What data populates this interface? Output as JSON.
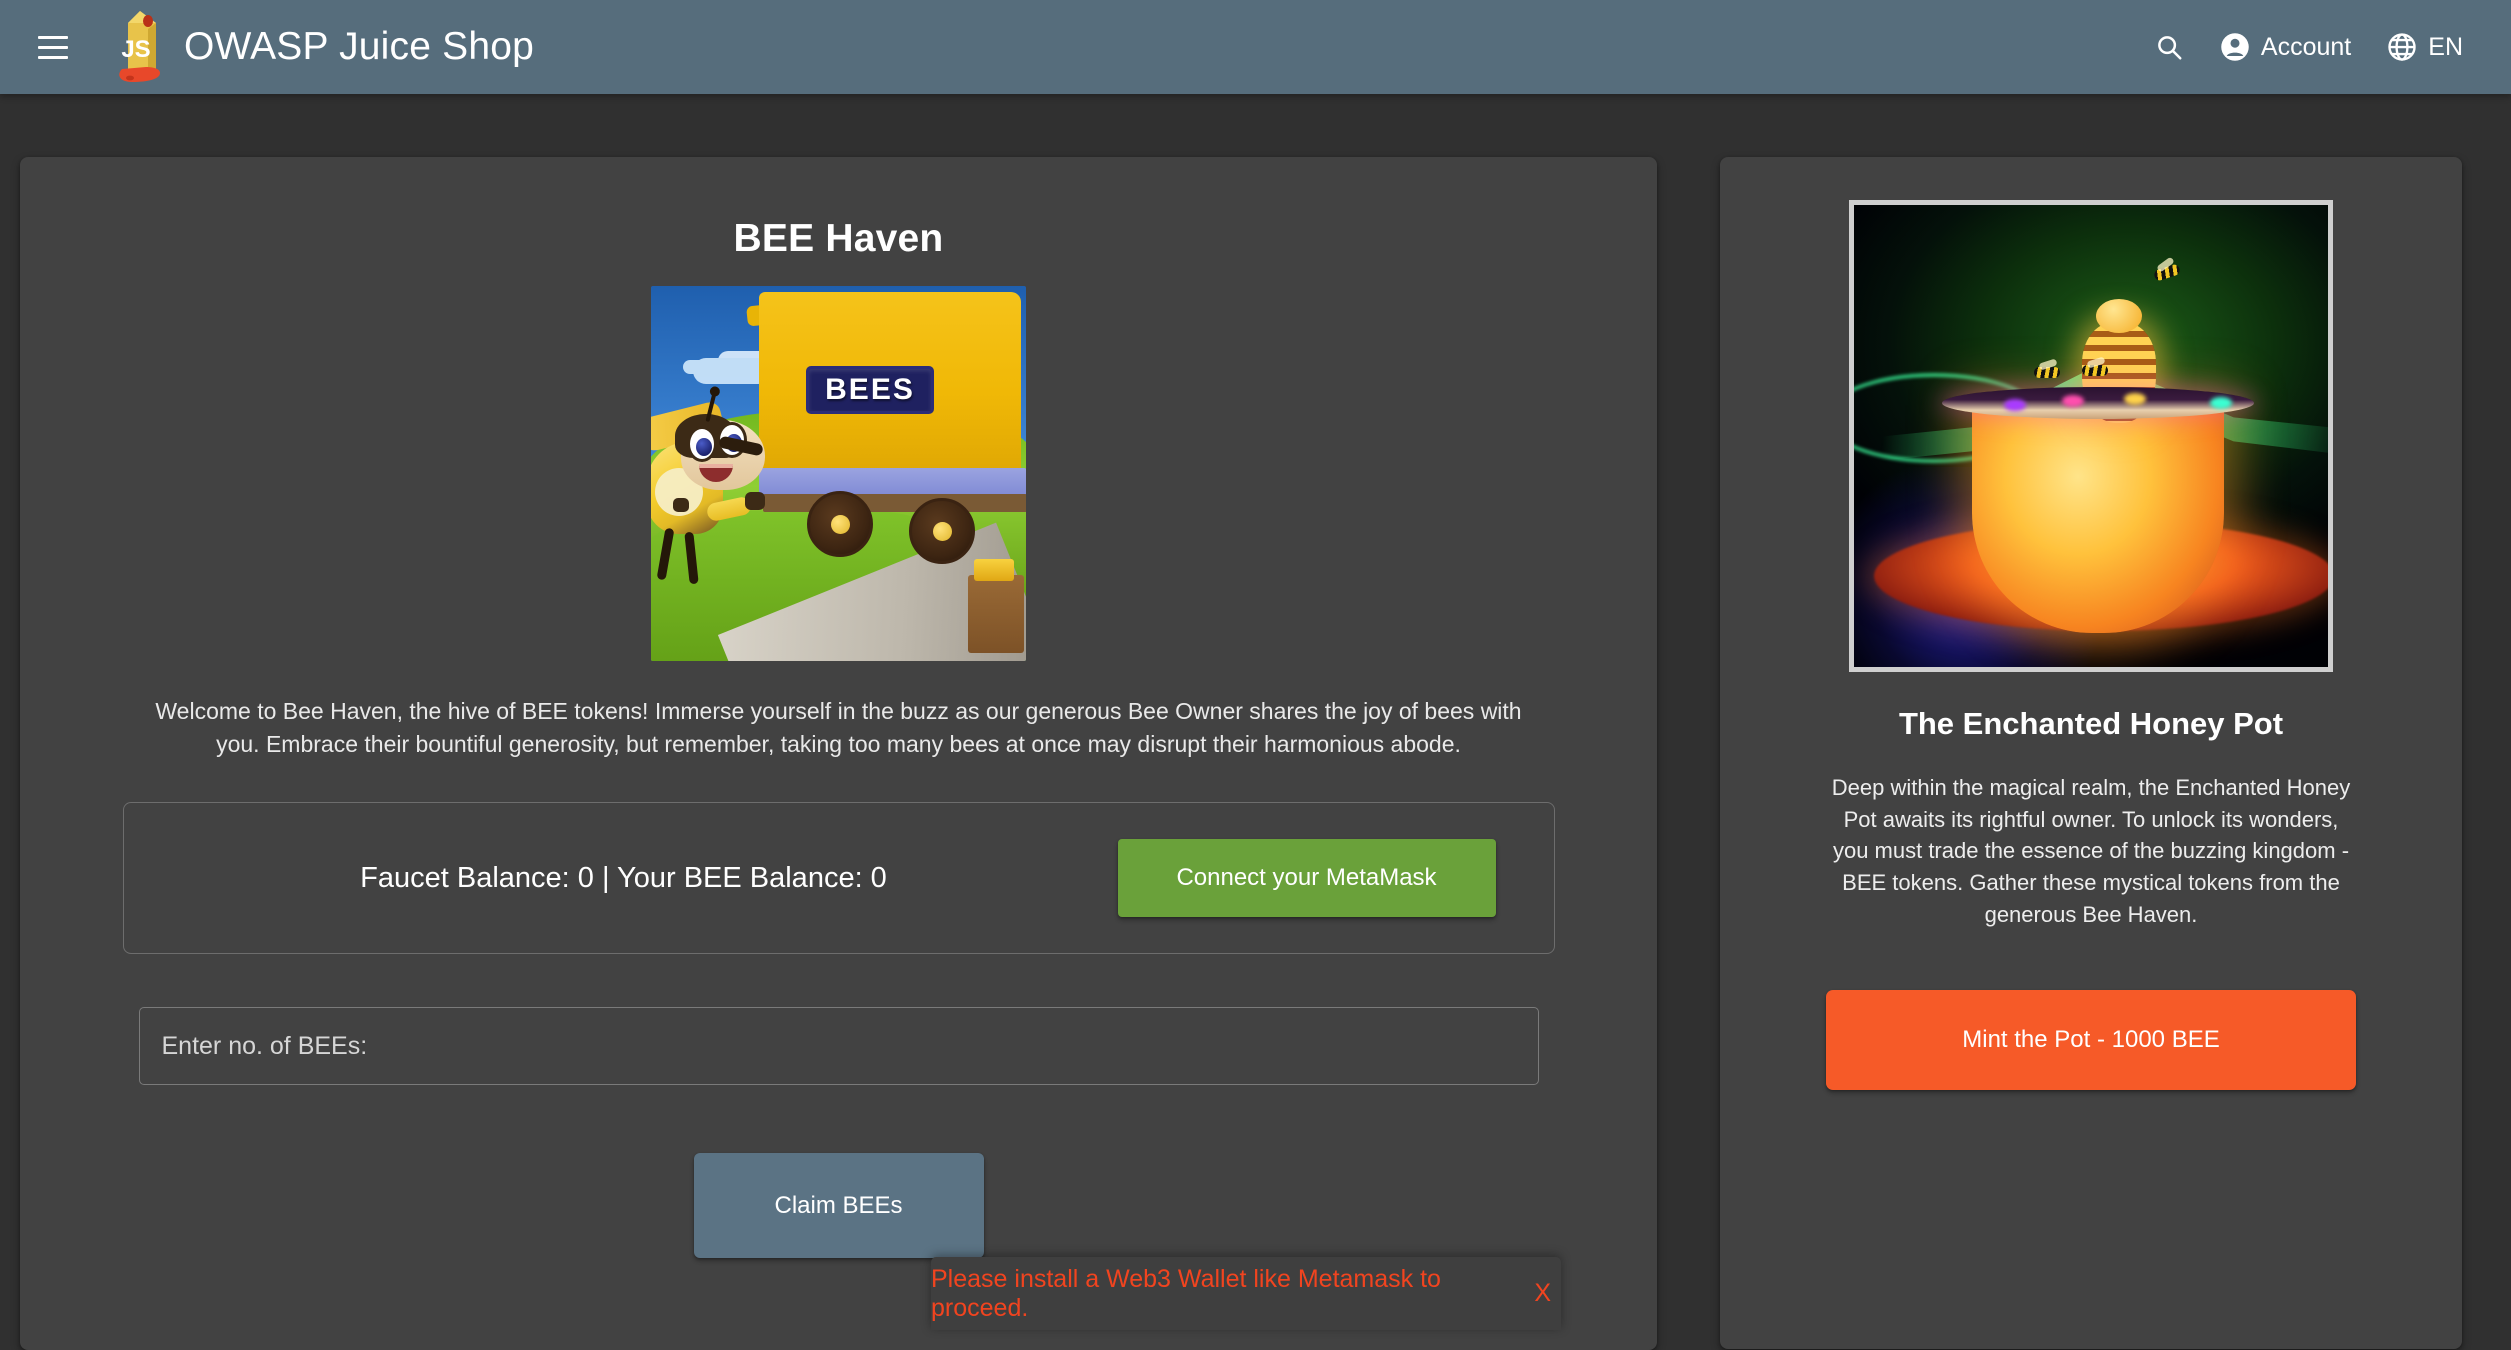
{
  "header": {
    "menu_icon": "hamburger-menu-icon",
    "brand": "OWASP Juice Shop",
    "logo_icon": "juice-shop-logo-icon",
    "search_icon": "search-icon",
    "account_label": "Account",
    "account_icon": "account-circle-icon",
    "language_label": "EN",
    "language_icon": "globe-icon",
    "background_color": "#566d7c"
  },
  "faucet": {
    "title": "BEE Haven",
    "image_alt": "bees-delivery-truck-illustration",
    "image_sign_text": "BEES",
    "description": "Welcome to Bee Haven, the hive of BEE tokens! Immerse yourself in the buzz as our generous Bee Owner shares the joy of bees with you. Embrace their bountiful generosity, but remember, taking too many bees at once may disrupt their harmonious abode.",
    "balance_text": "Faucet Balance: 0 | Your BEE Balance: 0",
    "faucet_balance": "0",
    "user_bee_balance": "0",
    "connect_button": "Connect your MetaMask",
    "connect_button_color": "#6aa13a",
    "input_placeholder": "Enter no. of BEEs:",
    "input_value": "",
    "claim_button": "Claim BEEs",
    "claim_button_color": "#5b7384"
  },
  "nft": {
    "image_alt": "enchanted-honey-pot-neon-artwork",
    "title": "The Enchanted Honey Pot",
    "description": "Deep within the magical realm, the Enchanted Honey Pot awaits its rightful owner. To unlock its wonders, you must trade the essence of the buzzing kingdom - BEE tokens. Gather these mystical tokens from the generous Bee Haven.",
    "mint_button": "Mint the Pot - 1000 BEE",
    "mint_button_color": "#f65a28"
  },
  "snackbar": {
    "message": "Please install a Web3 Wallet like Metamask to proceed.",
    "close_label": "X",
    "text_color": "#f1441f"
  },
  "theme": {
    "page_background": "#303030",
    "card_background": "#424242"
  }
}
